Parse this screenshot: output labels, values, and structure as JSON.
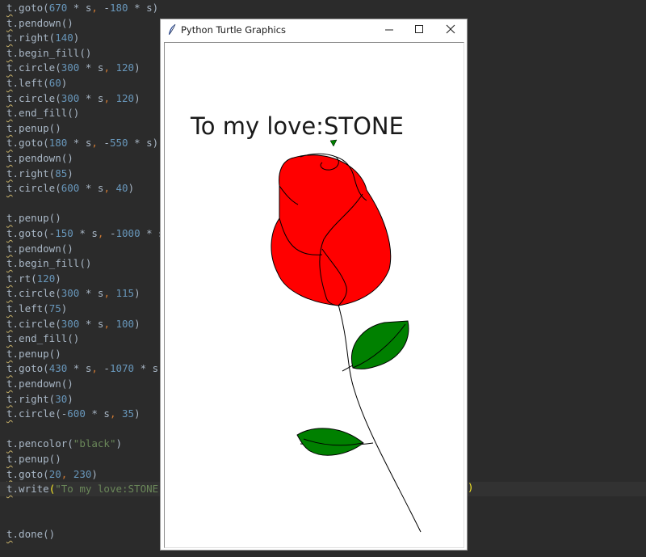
{
  "editor": {
    "lines": [
      {
        "obj": "t",
        "parts": [
          {
            "c": ".goto(",
            "k": "p"
          },
          {
            "c": "670",
            "k": "n"
          },
          {
            "c": " * s",
            "k": "p"
          },
          {
            "c": ",",
            "k": "c"
          },
          {
            "c": " -",
            "k": "p"
          },
          {
            "c": "180",
            "k": "n"
          },
          {
            "c": " * s)",
            "k": "p"
          }
        ]
      },
      {
        "obj": "t",
        "parts": [
          {
            "c": ".pendown()",
            "k": "p"
          }
        ]
      },
      {
        "obj": "t",
        "parts": [
          {
            "c": ".right(",
            "k": "p"
          },
          {
            "c": "140",
            "k": "n"
          },
          {
            "c": ")",
            "k": "p"
          }
        ]
      },
      {
        "obj": "t",
        "parts": [
          {
            "c": ".begin_fill()",
            "k": "p"
          }
        ]
      },
      {
        "obj": "t",
        "parts": [
          {
            "c": ".circle(",
            "k": "p"
          },
          {
            "c": "300",
            "k": "n"
          },
          {
            "c": " * s",
            "k": "p"
          },
          {
            "c": ",",
            "k": "c"
          },
          {
            "c": " ",
            "k": "p"
          },
          {
            "c": "120",
            "k": "n"
          },
          {
            "c": ")",
            "k": "p"
          }
        ]
      },
      {
        "obj": "t",
        "parts": [
          {
            "c": ".left(",
            "k": "p"
          },
          {
            "c": "60",
            "k": "n"
          },
          {
            "c": ")",
            "k": "p"
          }
        ]
      },
      {
        "obj": "t",
        "parts": [
          {
            "c": ".circle(",
            "k": "p"
          },
          {
            "c": "300",
            "k": "n"
          },
          {
            "c": " * s",
            "k": "p"
          },
          {
            "c": ",",
            "k": "c"
          },
          {
            "c": " ",
            "k": "p"
          },
          {
            "c": "120",
            "k": "n"
          },
          {
            "c": ")",
            "k": "p"
          }
        ]
      },
      {
        "obj": "t",
        "parts": [
          {
            "c": ".end_fill()",
            "k": "p"
          }
        ]
      },
      {
        "obj": "t",
        "parts": [
          {
            "c": ".penup()",
            "k": "p"
          }
        ]
      },
      {
        "obj": "t",
        "parts": [
          {
            "c": ".goto(",
            "k": "p"
          },
          {
            "c": "180",
            "k": "n"
          },
          {
            "c": " * s",
            "k": "p"
          },
          {
            "c": ",",
            "k": "c"
          },
          {
            "c": " -",
            "k": "p"
          },
          {
            "c": "550",
            "k": "n"
          },
          {
            "c": " * s)",
            "k": "p"
          }
        ]
      },
      {
        "obj": "t",
        "parts": [
          {
            "c": ".pendown()",
            "k": "p"
          }
        ]
      },
      {
        "obj": "t",
        "parts": [
          {
            "c": ".right(",
            "k": "p"
          },
          {
            "c": "85",
            "k": "n"
          },
          {
            "c": ")",
            "k": "p"
          }
        ]
      },
      {
        "obj": "t",
        "parts": [
          {
            "c": ".circle(",
            "k": "p"
          },
          {
            "c": "600",
            "k": "n"
          },
          {
            "c": " * s",
            "k": "p"
          },
          {
            "c": ",",
            "k": "c"
          },
          {
            "c": " ",
            "k": "p"
          },
          {
            "c": "40",
            "k": "n"
          },
          {
            "c": ")",
            "k": "p"
          }
        ]
      },
      {
        "obj": "",
        "parts": []
      },
      {
        "obj": "t",
        "parts": [
          {
            "c": ".penup()",
            "k": "p"
          }
        ]
      },
      {
        "obj": "t",
        "parts": [
          {
            "c": ".goto(-",
            "k": "p"
          },
          {
            "c": "150",
            "k": "n"
          },
          {
            "c": " * s",
            "k": "p"
          },
          {
            "c": ",",
            "k": "c"
          },
          {
            "c": " -",
            "k": "p"
          },
          {
            "c": "1000",
            "k": "n"
          },
          {
            "c": " * s)",
            "k": "p"
          }
        ]
      },
      {
        "obj": "t",
        "parts": [
          {
            "c": ".pendown()",
            "k": "p"
          }
        ]
      },
      {
        "obj": "t",
        "parts": [
          {
            "c": ".begin_fill()",
            "k": "p"
          }
        ]
      },
      {
        "obj": "t",
        "parts": [
          {
            "c": ".rt(",
            "k": "p"
          },
          {
            "c": "120",
            "k": "n"
          },
          {
            "c": ")",
            "k": "p"
          }
        ]
      },
      {
        "obj": "t",
        "parts": [
          {
            "c": ".circle(",
            "k": "p"
          },
          {
            "c": "300",
            "k": "n"
          },
          {
            "c": " * s",
            "k": "p"
          },
          {
            "c": ",",
            "k": "c"
          },
          {
            "c": " ",
            "k": "p"
          },
          {
            "c": "115",
            "k": "n"
          },
          {
            "c": ")",
            "k": "p"
          }
        ]
      },
      {
        "obj": "t",
        "parts": [
          {
            "c": ".left(",
            "k": "p"
          },
          {
            "c": "75",
            "k": "n"
          },
          {
            "c": ")",
            "k": "p"
          }
        ]
      },
      {
        "obj": "t",
        "parts": [
          {
            "c": ".circle(",
            "k": "p"
          },
          {
            "c": "300",
            "k": "n"
          },
          {
            "c": " * s",
            "k": "p"
          },
          {
            "c": ",",
            "k": "c"
          },
          {
            "c": " ",
            "k": "p"
          },
          {
            "c": "100",
            "k": "n"
          },
          {
            "c": ")",
            "k": "p"
          }
        ]
      },
      {
        "obj": "t",
        "parts": [
          {
            "c": ".end_fill()",
            "k": "p"
          }
        ]
      },
      {
        "obj": "t",
        "parts": [
          {
            "c": ".penup()",
            "k": "p"
          }
        ]
      },
      {
        "obj": "t",
        "parts": [
          {
            "c": ".goto(",
            "k": "p"
          },
          {
            "c": "430",
            "k": "n"
          },
          {
            "c": " * s",
            "k": "p"
          },
          {
            "c": ",",
            "k": "c"
          },
          {
            "c": " -",
            "k": "p"
          },
          {
            "c": "1070",
            "k": "n"
          },
          {
            "c": " * s)",
            "k": "p"
          }
        ]
      },
      {
        "obj": "t",
        "parts": [
          {
            "c": ".pendown()",
            "k": "p"
          }
        ]
      },
      {
        "obj": "t",
        "parts": [
          {
            "c": ".right(",
            "k": "p"
          },
          {
            "c": "30",
            "k": "n"
          },
          {
            "c": ")",
            "k": "p"
          }
        ]
      },
      {
        "obj": "t",
        "parts": [
          {
            "c": ".circle(-",
            "k": "p"
          },
          {
            "c": "600",
            "k": "n"
          },
          {
            "c": " * s",
            "k": "p"
          },
          {
            "c": ",",
            "k": "c"
          },
          {
            "c": " ",
            "k": "p"
          },
          {
            "c": "35",
            "k": "n"
          },
          {
            "c": ")",
            "k": "p"
          }
        ]
      },
      {
        "obj": "",
        "parts": []
      },
      {
        "obj": "t",
        "parts": [
          {
            "c": ".pencolor(",
            "k": "p"
          },
          {
            "c": "\"black\"",
            "k": "s"
          },
          {
            "c": ")",
            "k": "p"
          }
        ]
      },
      {
        "obj": "t",
        "parts": [
          {
            "c": ".penup()",
            "k": "p"
          }
        ]
      },
      {
        "obj": "t",
        "parts": [
          {
            "c": ".goto(",
            "k": "p"
          },
          {
            "c": "20",
            "k": "n"
          },
          {
            "c": ",",
            "k": "c"
          },
          {
            "c": " ",
            "k": "p"
          },
          {
            "c": "230",
            "k": "n"
          },
          {
            "c": ")",
            "k": "p"
          }
        ]
      },
      {
        "obj": "t",
        "current": true,
        "parts": [
          {
            "c": ".write",
            "k": "p"
          },
          {
            "c": "(",
            "k": "h"
          },
          {
            "c": "\"To my love:STONE\"",
            "k": "s"
          },
          {
            "c": ",",
            "k": "c"
          }
        ]
      },
      {
        "obj": "",
        "parts": []
      },
      {
        "obj": "",
        "parts": []
      },
      {
        "obj": "t",
        "parts": [
          {
            "c": ".done()",
            "k": "p"
          }
        ]
      }
    ],
    "hidden_line_tail": ")"
  },
  "window": {
    "title": "Python Turtle Graphics",
    "minimize_glyph": "—",
    "maximize_glyph": "☐",
    "close_glyph": "✕",
    "written_text": "To my love:STONE"
  },
  "colors": {
    "editor_bg": "#2b2b2b",
    "rose_fill": "#ff0000",
    "leaf_fill": "#008000",
    "ink": "#000000"
  }
}
